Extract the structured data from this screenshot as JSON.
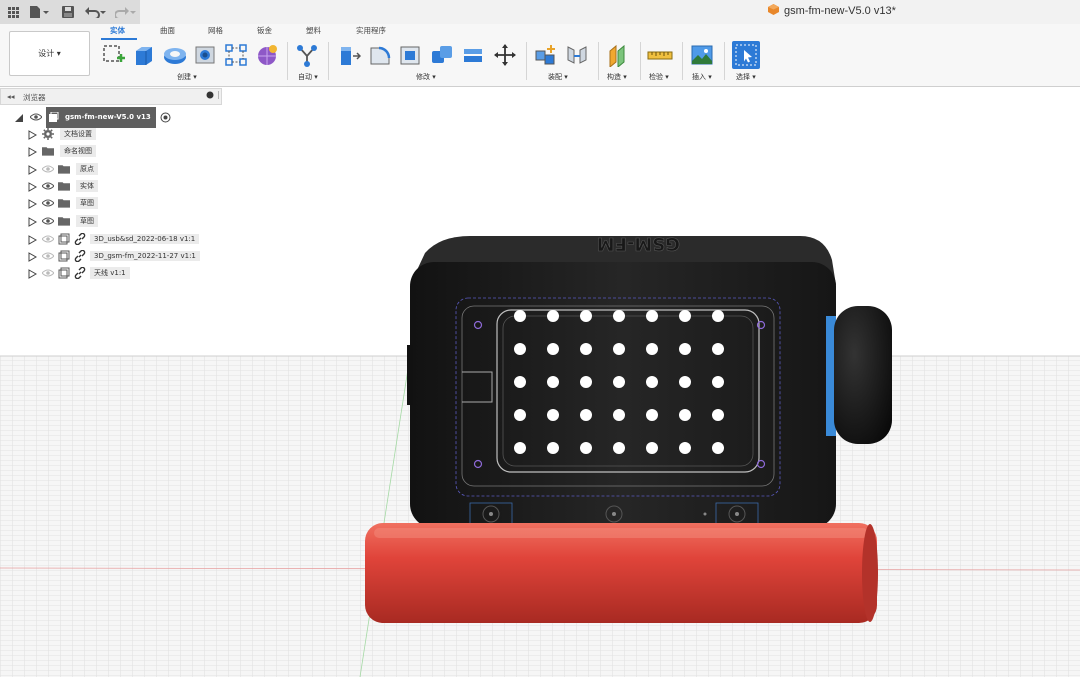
{
  "title_bar": {
    "document_title": "gsm-fm-new-V5.0 v13*"
  },
  "quick_access": {
    "icons": [
      "apps-grid-icon",
      "file-icon",
      "save-icon",
      "undo-icon",
      "redo-icon"
    ]
  },
  "ribbon": {
    "workspace": "设计 ▾",
    "tabs": [
      {
        "label": "实体",
        "active": true
      },
      {
        "label": "曲面"
      },
      {
        "label": "网格"
      },
      {
        "label": "钣金"
      },
      {
        "label": "塑料"
      },
      {
        "label": "实用程序"
      }
    ],
    "groups": {
      "create": "创建 ▾",
      "automate": "自动 ▾",
      "modify": "修改 ▾",
      "assemble": "装配 ▾",
      "construct": "构造 ▾",
      "inspect": "检验 ▾",
      "insert": "插入 ▾",
      "select": "选择 ▾"
    },
    "accent_color": "#2d7ad6"
  },
  "browser": {
    "header": "浏览器",
    "root": "gsm-fm-new-V5.0 v13",
    "items": [
      {
        "label": "文档设置"
      },
      {
        "label": "命名视图"
      },
      {
        "label": "原点"
      },
      {
        "label": "实体"
      },
      {
        "label": "草图"
      },
      {
        "label": "草图"
      },
      {
        "label": "3D_usb&sd_2022-06-18 v1:1"
      },
      {
        "label": "3D_gsm-fm_2022-11-27 v1:1"
      },
      {
        "label": "天线 v1:1"
      }
    ]
  },
  "model": {
    "embossed_text": "GSM-FM",
    "body_color": "#1e1e1e",
    "battery_color": "#e0443a",
    "grid_holes": {
      "rows": 5,
      "cols": 7
    }
  }
}
